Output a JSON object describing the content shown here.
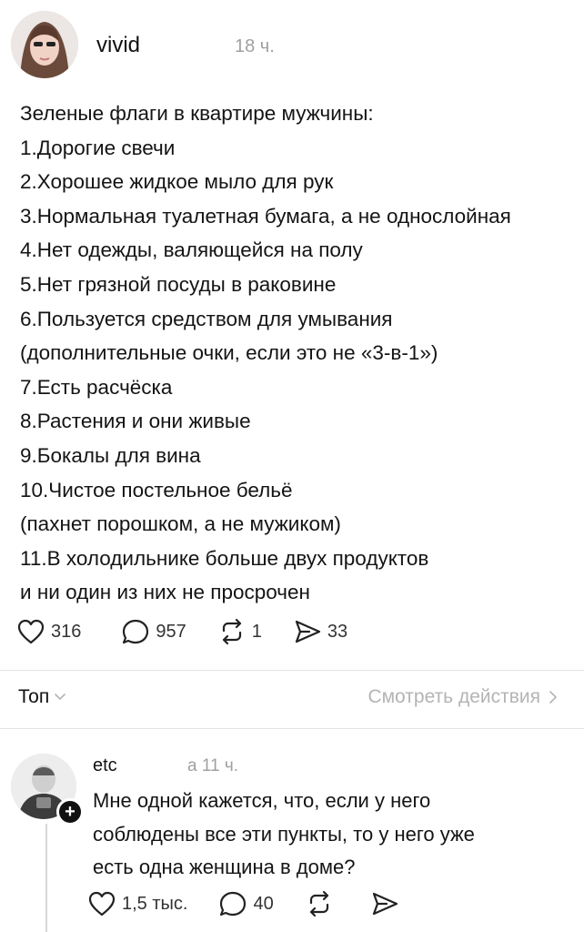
{
  "post": {
    "author": "vivid",
    "time": "18 ч.",
    "lines": [
      "Зеленые флаги в квартире мужчины:",
      "1.Дорогие свечи",
      "2.Хорошее жидкое мыло для рук",
      "3.Нормальная туалетная бумага, а не однослойная",
      "4.Нет одежды, валяющейся на полу",
      "5.Нет грязной посуды в раковине",
      "6.Пользуется средством для умывания",
      "(дополнительные очки, если это не «3-в-1»)",
      "7.Есть расчёска",
      "8.Растения и они живые",
      "9.Бокалы для вина",
      "10.Чистое постельное бельё",
      "(пахнет порошком, а не мужиком)",
      "11.В холодильнике больше двух продуктов",
      "и ни один из них не просрочен"
    ],
    "likes": "316",
    "replies": "957",
    "reposts": "1",
    "shares": "33"
  },
  "sort": {
    "label": "Топ",
    "activity_link": "Смотреть действия"
  },
  "comment": {
    "author": "etc",
    "time": "a 11 ч.",
    "lines": [
      "Мне одной кажется, что, если у него",
      "соблюдены все эти пункты, то у него уже",
      "есть одна женщина в доме?"
    ],
    "likes": "1,5 тыс.",
    "replies": "40",
    "follow_symbol": "+"
  },
  "icons": {
    "like": "heart-icon",
    "reply": "comment-bubble-icon",
    "repost": "repost-icon",
    "share": "send-icon",
    "chevron": "chevron-icon"
  }
}
